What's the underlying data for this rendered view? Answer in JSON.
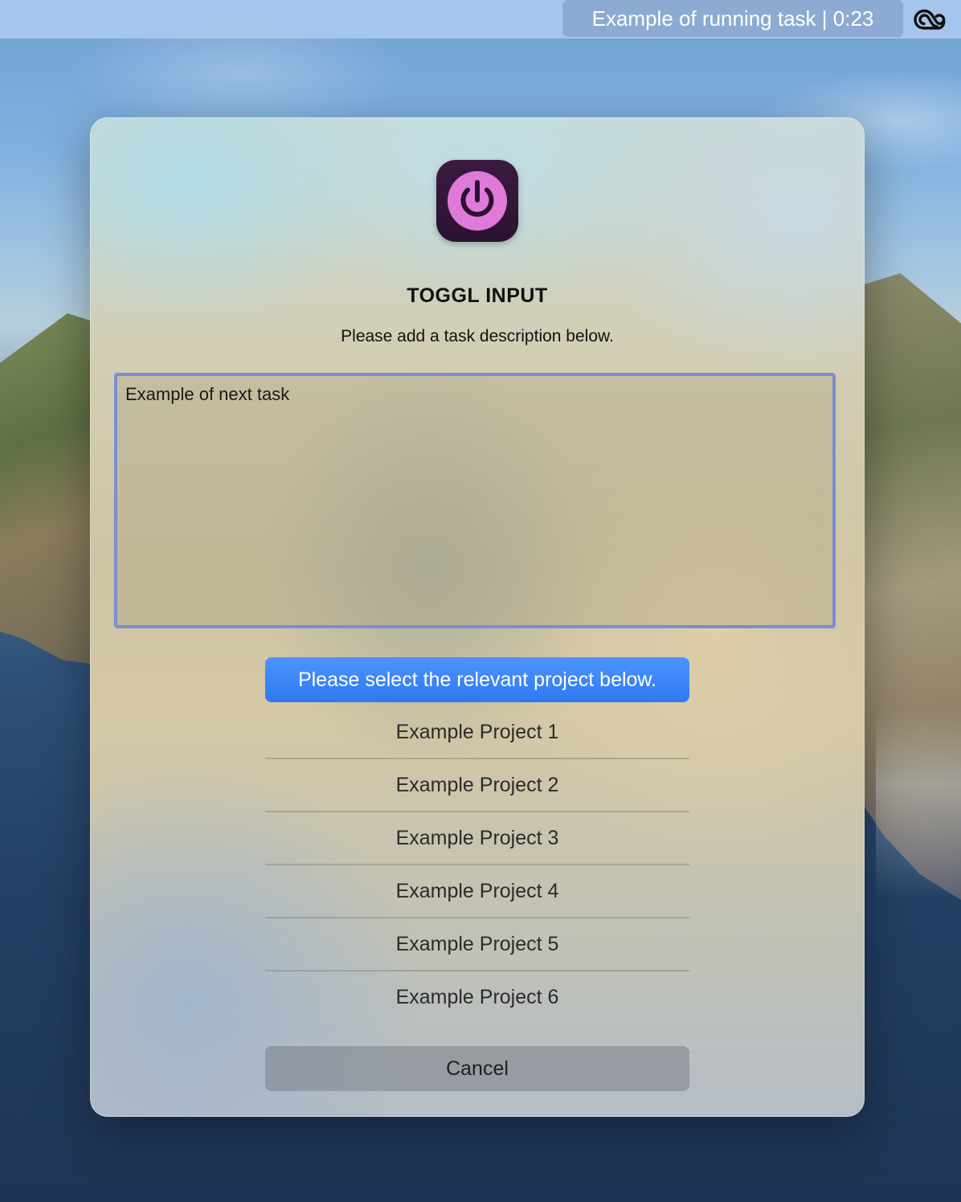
{
  "menubar": {
    "running_task": "Example of running task | 0:23",
    "status_icon": "creative-cloud-icon"
  },
  "dialog": {
    "app_icon": "toggl-power-icon",
    "title": "TOGGL INPUT",
    "subtitle": "Please add a task description below.",
    "task_input": {
      "value": "Example of next task",
      "placeholder": ""
    },
    "project_header": "Please select the relevant project below.",
    "projects": [
      "Example Project 1",
      "Example Project 2",
      "Example Project 3",
      "Example Project 4",
      "Example Project 5",
      "Example Project 6"
    ],
    "cancel_label": "Cancel"
  },
  "colors": {
    "accent_blue": "#2f78f1",
    "input_focus_border": "#7b8ed2",
    "toggl_pink": "#e07ad8",
    "toggl_icon_bg": "#2a1230"
  }
}
